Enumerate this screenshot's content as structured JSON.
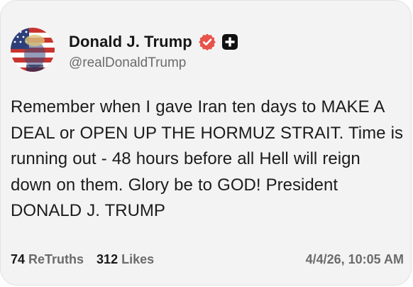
{
  "colors": {
    "card_background": "#f3f3f3",
    "verified_badge": "#e8534a",
    "truth_logo": "#111111",
    "secondary_text": "#6b6b6b"
  },
  "post": {
    "author": {
      "display_name": "Donald J. Trump",
      "handle": "@realDonaldTrump",
      "verified_icon": "verified-badge-icon",
      "platform_icon": "truth-social-logo-icon"
    },
    "text": "Remember when I gave Iran ten days to MAKE A DEAL or OPEN UP THE HORMUZ STRAIT. Time is running out - 48 hours before all Hell will reign down on them. Glory be to GOD! President DONALD J. TRUMP",
    "stats": {
      "retruths_count": "74",
      "retruths_label": "ReTruths",
      "likes_count": "312",
      "likes_label": "Likes"
    },
    "timestamp": "4/4/26, 10:05 AM"
  }
}
